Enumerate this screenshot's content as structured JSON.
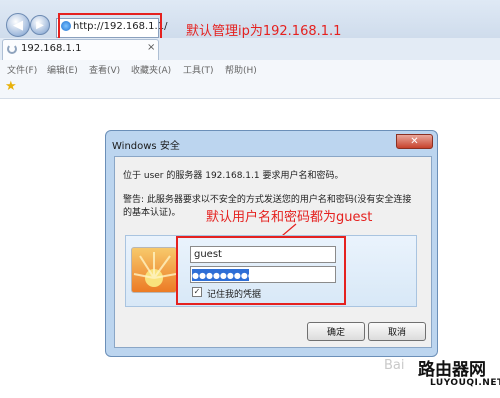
{
  "browser": {
    "address_url": "http://192.168.1.1/",
    "tab_title": "192.168.1.1",
    "menu": [
      "文件(F)",
      "编辑(E)",
      "查看(V)",
      "收藏夹(A)",
      "工具(T)",
      "帮助(H)"
    ]
  },
  "annotations": {
    "ip_note": "默认管理ip为192.168.1.1",
    "cred_note": "默认用户名和密码都为guest"
  },
  "dialog": {
    "title": "Windows 安全",
    "line1": "位于 user 的服务器 192.168.1.1 要求用户名和密码。",
    "warning_line1": "警告: 此服务器要求以不安全的方式发送您的用户名和密码(没有安全连接",
    "warning_line2": "的基本认证)。",
    "username_value": "guest",
    "password_value": "●●●●●●●●●●",
    "remember_label": "记住我的凭据",
    "ok_label": "确定",
    "cancel_label": "取消"
  },
  "watermark": {
    "site_cn": "路由器网",
    "site_url": "LUYOUQI.NET",
    "baidu": "Bai"
  },
  "colors": {
    "annotation_red": "#e5211f",
    "highlight_blue": "#2f6fd6"
  }
}
